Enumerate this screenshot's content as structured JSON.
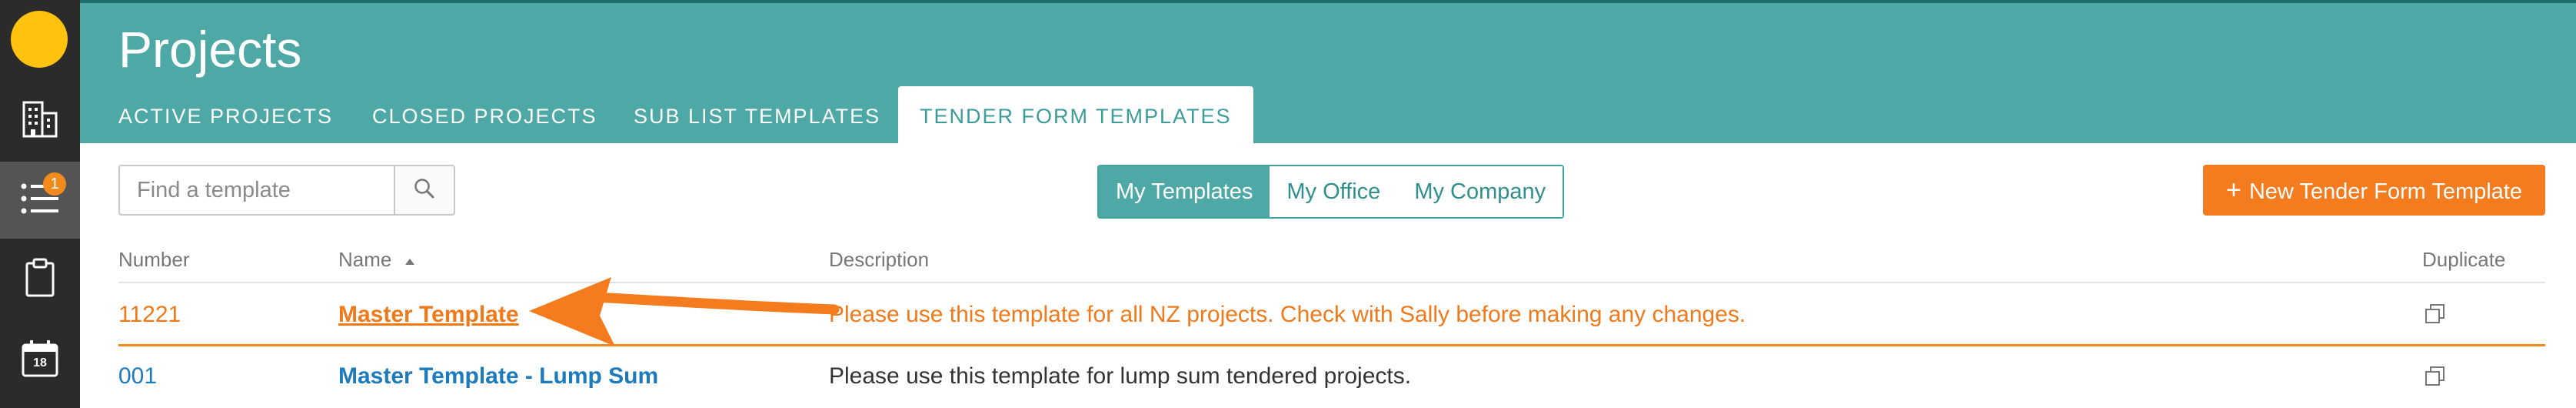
{
  "app": {
    "title": "Projects"
  },
  "sidebar": {
    "items": [
      {
        "icon": "logo-circle"
      },
      {
        "icon": "building-icon"
      },
      {
        "icon": "list-icon",
        "badge": "1"
      },
      {
        "icon": "clipboard-icon"
      },
      {
        "icon": "calendar-icon",
        "calendar_day": "18"
      }
    ]
  },
  "tabs": [
    {
      "label": "ACTIVE PROJECTS"
    },
    {
      "label": "CLOSED PROJECTS"
    },
    {
      "label": "SUB LIST TEMPLATES"
    },
    {
      "label": "TENDER FORM TEMPLATES"
    }
  ],
  "toolbar": {
    "search_placeholder": "Find a template",
    "filters": [
      "My Templates",
      "My Office",
      "My Company"
    ],
    "new_button_label": "New Tender Form Template",
    "new_button_prefix": "+"
  },
  "table": {
    "columns": {
      "number": "Number",
      "name": "Name",
      "description": "Description",
      "duplicate": "Duplicate"
    },
    "rows": [
      {
        "number": "11221",
        "name": "Master Template",
        "description": "Please use this template for all NZ projects. Check with Sally before making any changes."
      },
      {
        "number": "001",
        "name": "Master Template - Lump Sum",
        "description": "Please use this template for lump sum tendered projects."
      }
    ]
  },
  "colors": {
    "header": "#4ea9a6",
    "accent_orange": "#f47c1f",
    "link_blue": "#1b7bbd",
    "sidebar": "#2b2b2b"
  }
}
